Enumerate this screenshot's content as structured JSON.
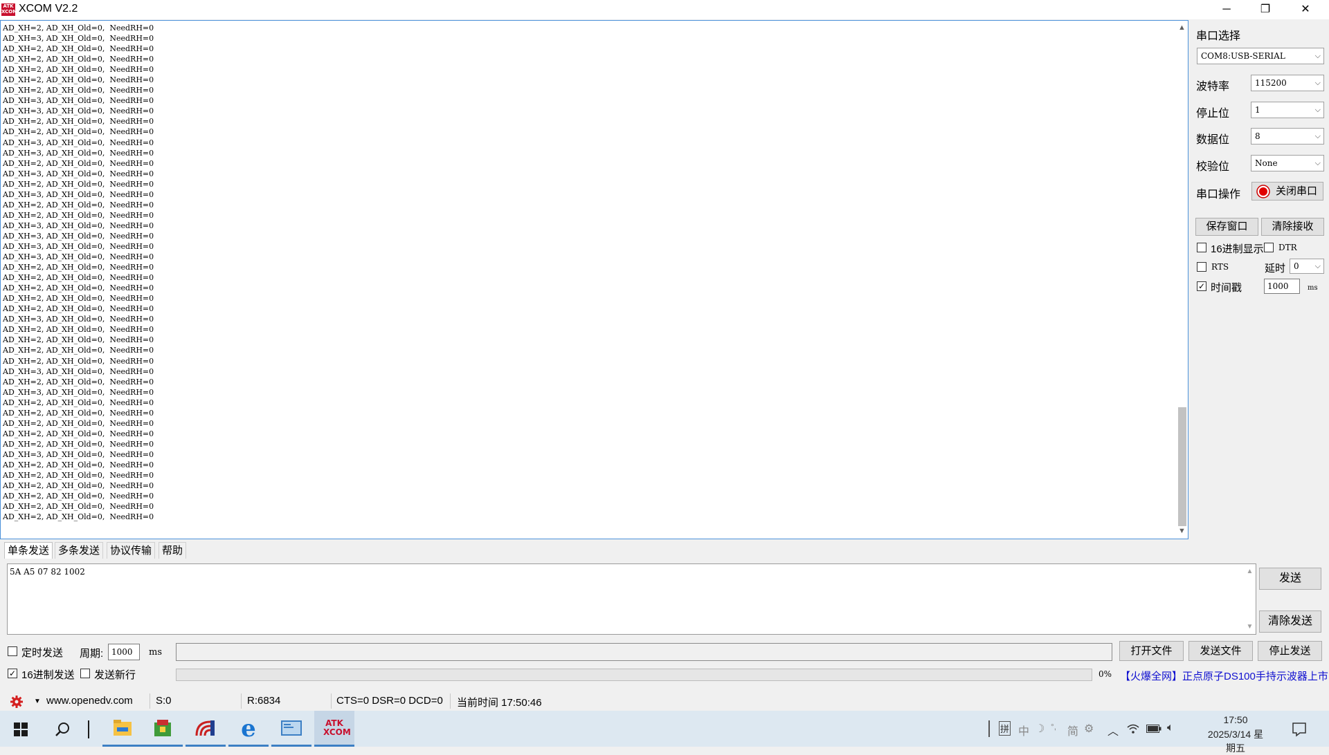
{
  "window": {
    "title": "XCOM V2.2",
    "logo_text_top": "ATK",
    "logo_text_bottom": "XCOM",
    "minimize": "─",
    "restore": "❐",
    "close": "✕"
  },
  "receive": {
    "lines": [
      "AD_XH=2, AD_XH_Old=0,  NeedRH=0",
      "AD_XH=3, AD_XH_Old=0,  NeedRH=0",
      "AD_XH=2, AD_XH_Old=0,  NeedRH=0",
      "AD_XH=2, AD_XH_Old=0,  NeedRH=0",
      "AD_XH=2, AD_XH_Old=0,  NeedRH=0",
      "AD_XH=2, AD_XH_Old=0,  NeedRH=0",
      "AD_XH=2, AD_XH_Old=0,  NeedRH=0",
      "AD_XH=3, AD_XH_Old=0,  NeedRH=0",
      "AD_XH=3, AD_XH_Old=0,  NeedRH=0",
      "AD_XH=2, AD_XH_Old=0,  NeedRH=0",
      "AD_XH=2, AD_XH_Old=0,  NeedRH=0",
      "AD_XH=3, AD_XH_Old=0,  NeedRH=0",
      "AD_XH=3, AD_XH_Old=0,  NeedRH=0",
      "AD_XH=2, AD_XH_Old=0,  NeedRH=0",
      "AD_XH=3, AD_XH_Old=0,  NeedRH=0",
      "AD_XH=2, AD_XH_Old=0,  NeedRH=0",
      "AD_XH=3, AD_XH_Old=0,  NeedRH=0",
      "AD_XH=2, AD_XH_Old=0,  NeedRH=0",
      "AD_XH=2, AD_XH_Old=0,  NeedRH=0",
      "AD_XH=3, AD_XH_Old=0,  NeedRH=0",
      "AD_XH=3, AD_XH_Old=0,  NeedRH=0",
      "AD_XH=3, AD_XH_Old=0,  NeedRH=0",
      "AD_XH=3, AD_XH_Old=0,  NeedRH=0",
      "AD_XH=2, AD_XH_Old=0,  NeedRH=0",
      "AD_XH=2, AD_XH_Old=0,  NeedRH=0",
      "AD_XH=2, AD_XH_Old=0,  NeedRH=0",
      "AD_XH=2, AD_XH_Old=0,  NeedRH=0",
      "AD_XH=2, AD_XH_Old=0,  NeedRH=0",
      "AD_XH=3, AD_XH_Old=0,  NeedRH=0",
      "AD_XH=2, AD_XH_Old=0,  NeedRH=0",
      "AD_XH=2, AD_XH_Old=0,  NeedRH=0",
      "AD_XH=2, AD_XH_Old=0,  NeedRH=0",
      "AD_XH=2, AD_XH_Old=0,  NeedRH=0",
      "AD_XH=3, AD_XH_Old=0,  NeedRH=0",
      "AD_XH=2, AD_XH_Old=0,  NeedRH=0",
      "AD_XH=3, AD_XH_Old=0,  NeedRH=0",
      "AD_XH=2, AD_XH_Old=0,  NeedRH=0",
      "AD_XH=2, AD_XH_Old=0,  NeedRH=0",
      "AD_XH=2, AD_XH_Old=0,  NeedRH=0",
      "AD_XH=2, AD_XH_Old=0,  NeedRH=0",
      "AD_XH=2, AD_XH_Old=0,  NeedRH=0",
      "AD_XH=3, AD_XH_Old=0,  NeedRH=0",
      "AD_XH=2, AD_XH_Old=0,  NeedRH=0",
      "AD_XH=2, AD_XH_Old=0,  NeedRH=0",
      "AD_XH=2, AD_XH_Old=0,  NeedRH=0",
      "AD_XH=2, AD_XH_Old=0,  NeedRH=0",
      "AD_XH=2, AD_XH_Old=0,  NeedRH=0",
      "AD_XH=2, AD_XH_Old=0,  NeedRH=0"
    ]
  },
  "settings": {
    "port_select_label": "串口选择",
    "port_value": "COM8:USB-SERIAL",
    "baud_label": "波特率",
    "baud_value": "115200",
    "stopbits_label": "停止位",
    "stopbits_value": "1",
    "databits_label": "数据位",
    "databits_value": "8",
    "parity_label": "校验位",
    "parity_value": "None",
    "port_op_label": "串口操作",
    "close_port_button": "关闭串口",
    "save_window_button": "保存窗口",
    "clear_receive_button": "清除接收",
    "hex_display_label": "16进制显示",
    "hex_display_checked": false,
    "dtr_label": "DTR",
    "dtr_checked": false,
    "rts_label": "RTS",
    "rts_checked": false,
    "delay_label": "延时",
    "delay_value": "0",
    "timestamp_label": "时间戳",
    "timestamp_checked": true,
    "timestamp_value": "1000",
    "timestamp_unit": "ms"
  },
  "tabs": [
    "单条发送",
    "多条发送",
    "协议传输",
    "帮助"
  ],
  "send": {
    "text": "5A A5 07 82 1002",
    "send_button": "发送",
    "clear_send_button": "清除发送",
    "timed_send_label": "定时发送",
    "timed_send_checked": false,
    "period_label": "周期:",
    "period_value": "1000",
    "period_unit": "ms",
    "hex_send_label": "16进制发送",
    "hex_send_checked": true,
    "newline_label": "发送新行",
    "newline_checked": false,
    "open_file_button": "打开文件",
    "send_file_button": "发送文件",
    "stop_send_button": "停止发送",
    "progress_percent": "0%",
    "progress_value": 0,
    "ad_text": "【火爆全网】正点原子DS100手持示波器上市"
  },
  "statusbar": {
    "website": "www.openedv.com",
    "sent": "S:0",
    "received": "R:6834",
    "signals": "CTS=0 DSR=0 DCD=0",
    "current_time": "当前时间 17:50:46"
  },
  "taskbar": {
    "time": "17:50",
    "date": "2025/3/14 星期五",
    "ime_pin": "拼",
    "ime_cn": "中",
    "ime_simple": "简",
    "app_label": "ATK XCOM"
  },
  "colors": {
    "accent": "#3c7fc4",
    "ad_blue": "#1010d0",
    "logo_red": "#c8102e",
    "taskbar_bg": "#dde8f1"
  }
}
